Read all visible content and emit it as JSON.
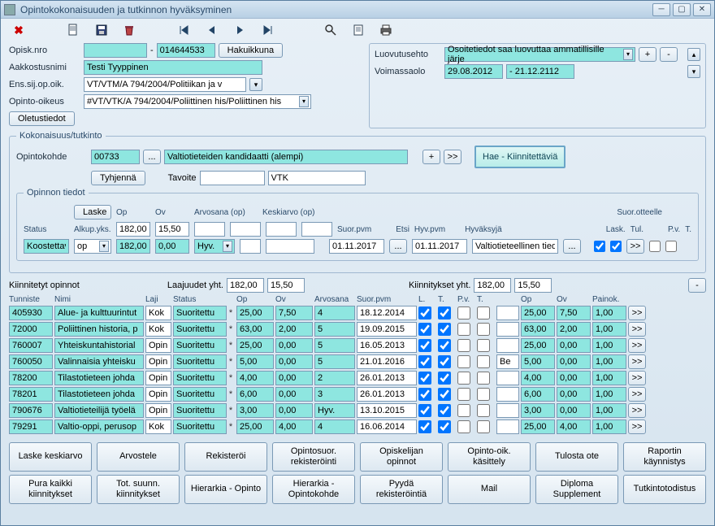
{
  "window": {
    "title": "Opintokokonaisuuden ja tutkinnon hyväksyminen"
  },
  "top": {
    "opisk_nro_label": "Opisk.nro",
    "opisk_nro_sep": "-",
    "opisk_nro_val": "014644533",
    "hakuikkuna": "Hakuikkuna",
    "aakkostus_label": "Aakkostusnimi",
    "aakkostus_val": "Testi Tyyppinen",
    "ensisij_label": "Ens.sij.op.oik.",
    "ensisij_val": "VT/VTM/A 794/2004/Politiikan ja v",
    "opinto_oikeus_label": "Opinto-oikeus",
    "opinto_oikeus_val": "#VT/VTK/A 794/2004/Poliittinen his/Poliittinen his",
    "oletustiedot": "Oletustiedot"
  },
  "right": {
    "luovutusehto_label": "Luovutusehto",
    "luovutusehto_val": "Osoitetiedot saa luovuttaa ammatillisille järje",
    "voimassaolo_label": "Voimassaolo",
    "voimassa_from": "29.08.2012",
    "voimassa_sep": "- 21.12.2112",
    "plus": "+",
    "minus": "-"
  },
  "kokonaisuus": {
    "legend": "Kokonaisuus/tutkinto",
    "opintokohde_label": "Opintokohde",
    "opintokohde_code": "00733",
    "opintokohde_name": "Valtiotieteiden kandidaatti (alempi)",
    "ellipsis": "...",
    "plus": "+",
    "next": ">>",
    "hae_btn": "Hae - Kiinnitettäviä",
    "tyhjenna": "Tyhjennä",
    "tavoite_label": "Tavoite",
    "tavoite_val": "VTK"
  },
  "opinnon": {
    "legend": "Opinnon tiedot",
    "laske": "Laske",
    "hdr_op": "Op",
    "hdr_ov": "Ov",
    "hdr_arv": "Arvosana (op)",
    "hdr_kesk": "Keskiarvo (op)",
    "status_label": "Status",
    "alkup_label": "Alkup.yks.",
    "suor_ott": "Suor.otteelle",
    "suor_pvm_label": "Suor.pvm",
    "etsi_label": "Etsi",
    "hyv_pvm_label": "Hyv.pvm",
    "hyvaksyja_label": "Hyväksyjä",
    "lask": "Lask.",
    "tul": "Tul.",
    "pv": "P.v.",
    "t": "T.",
    "status_val": "Koostettava",
    "op_sel": "op",
    "alkup_op": "182,00",
    "alkup_ov": "15,50",
    "op_val": "182,00",
    "ov_val": "0,00",
    "arv_val": "Hyv.",
    "suor_pvm": "01.11.2017",
    "hyv_pvm": "01.11.2017",
    "hyvaksyja": "Valtiotieteellinen tied",
    "next": ">>"
  },
  "kiin": {
    "label": "Kiinnitetyt opinnot",
    "laaj_label": "Laajuudet yht.",
    "laaj_op": "182,00",
    "laaj_ov": "15,50",
    "kiin_label": "Kiinnitykset yht.",
    "kiin_op": "182,00",
    "kiin_ov": "15,50",
    "hdr": {
      "tunniste": "Tunniste",
      "nimi": "Nimi",
      "laji": "Laji",
      "status": "Status",
      "op": "Op",
      "ov": "Ov",
      "arvosana": "Arvosana",
      "suorpvm": "Suor.pvm",
      "l": "L.",
      "t": "T.",
      "pv": "P.v.",
      "t2": "T.",
      "op2": "Op",
      "ov2": "Ov",
      "painok": "Painok."
    },
    "rows": [
      {
        "tun": "405930",
        "nimi": "Alue- ja kulttuurintut",
        "laji": "Kok",
        "status": "Suoritettu",
        "op": "25,00",
        "ov": "7,50",
        "arv": "4",
        "pvm": "18.12.2014",
        "l": true,
        "t": true,
        "pv": false,
        "t2": false,
        "ext": "",
        "kop": "25,00",
        "kov": "7,50",
        "pk": "1,00"
      },
      {
        "tun": "72000",
        "nimi": "Poliittinen historia, p",
        "laji": "Kok",
        "status": "Suoritettu",
        "op": "63,00",
        "ov": "2,00",
        "arv": "5",
        "pvm": "19.09.2015",
        "l": true,
        "t": true,
        "pv": false,
        "t2": false,
        "ext": "",
        "kop": "63,00",
        "kov": "2,00",
        "pk": "1,00"
      },
      {
        "tun": "760007",
        "nimi": "Yhteiskuntahistorial",
        "laji": "Opin",
        "status": "Suoritettu",
        "op": "25,00",
        "ov": "0,00",
        "arv": "5",
        "pvm": "16.05.2013",
        "l": true,
        "t": true,
        "pv": false,
        "t2": false,
        "ext": "",
        "kop": "25,00",
        "kov": "0,00",
        "pk": "1,00"
      },
      {
        "tun": "760050",
        "nimi": "Valinnaisia yhteisku",
        "laji": "Opin",
        "status": "Suoritettu",
        "op": "5,00",
        "ov": "0,00",
        "arv": "5",
        "pvm": "21.01.2016",
        "l": true,
        "t": true,
        "pv": false,
        "t2": false,
        "ext": "Be",
        "kop": "5,00",
        "kov": "0,00",
        "pk": "1,00"
      },
      {
        "tun": "78200",
        "nimi": "Tilastotieteen johda",
        "laji": "Opin",
        "status": "Suoritettu",
        "op": "4,00",
        "ov": "0,00",
        "arv": "2",
        "pvm": "26.01.2013",
        "l": true,
        "t": true,
        "pv": false,
        "t2": false,
        "ext": "",
        "kop": "4,00",
        "kov": "0,00",
        "pk": "1,00"
      },
      {
        "tun": "78201",
        "nimi": "Tilastotieteen johda",
        "laji": "Opin",
        "status": "Suoritettu",
        "op": "6,00",
        "ov": "0,00",
        "arv": "3",
        "pvm": "26.01.2013",
        "l": true,
        "t": true,
        "pv": false,
        "t2": false,
        "ext": "",
        "kop": "6,00",
        "kov": "0,00",
        "pk": "1,00"
      },
      {
        "tun": "790676",
        "nimi": "Valtiotieteilijä työelä",
        "laji": "Opin",
        "status": "Suoritettu",
        "op": "3,00",
        "ov": "0,00",
        "arv": "Hyv.",
        "pvm": "13.10.2015",
        "l": true,
        "t": true,
        "pv": false,
        "t2": false,
        "ext": "",
        "kop": "3,00",
        "kov": "0,00",
        "pk": "1,00"
      },
      {
        "tun": "79291",
        "nimi": "Valtio-oppi, perusop",
        "laji": "Kok",
        "status": "Suoritettu",
        "op": "25,00",
        "ov": "4,00",
        "arv": "4",
        "pvm": "16.06.2014",
        "l": true,
        "t": true,
        "pv": false,
        "t2": false,
        "ext": "",
        "kop": "25,00",
        "kov": "4,00",
        "pk": "1,00"
      }
    ]
  },
  "buttons": {
    "r1": [
      "Laske keskiarvo",
      "Arvostele",
      "Rekisteröi",
      "Opintosuor. rekisteröinti",
      "Opiskelijan opinnot",
      "Opinto-oik. käsittely",
      "Tulosta ote",
      "Raportin käynnistys"
    ],
    "r2": [
      "Pura kaikki kiinnitykset",
      "Tot. suunn. kiinnitykset",
      "Hierarkia - Opinto",
      "Hierarkia - Opintokohde",
      "Pyydä rekisteröintiä",
      "Mail",
      "Diploma Supplement",
      "Tutkintotodistus"
    ]
  }
}
